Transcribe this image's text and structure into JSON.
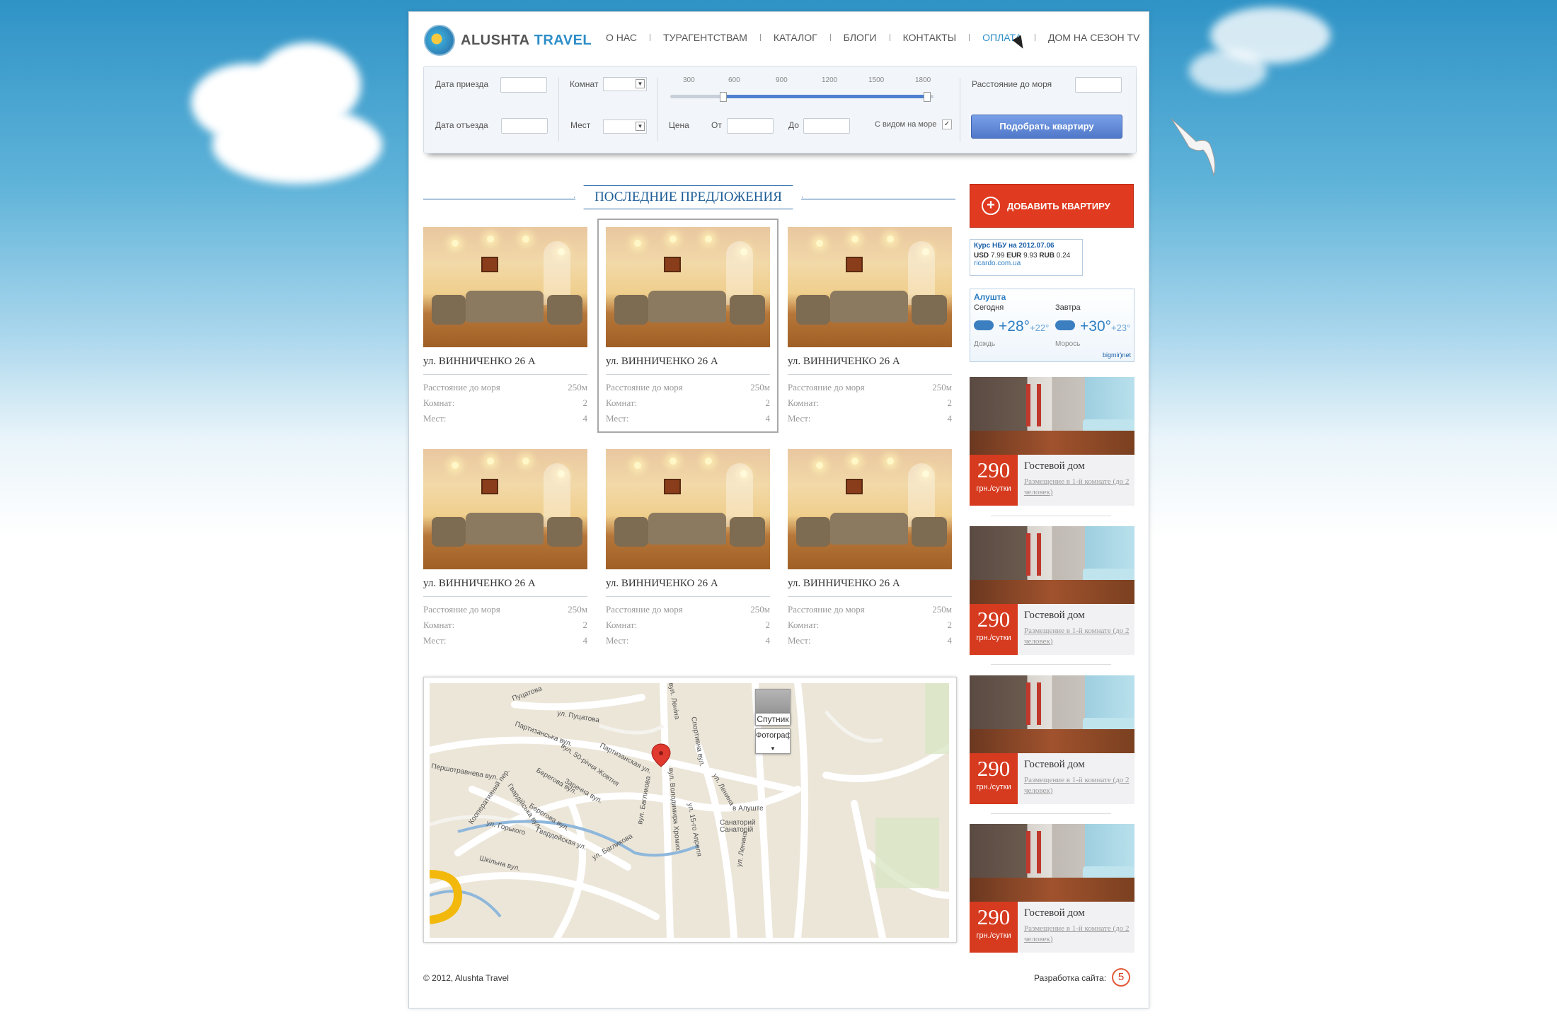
{
  "brand": {
    "name_part1": "ALUSHTA",
    "name_part2": "TRAVEL"
  },
  "nav": {
    "items": [
      {
        "label": "О НАС",
        "active": false
      },
      {
        "label": "ТУРАГЕНТСТВАМ",
        "active": false
      },
      {
        "label": "КАТАЛОГ",
        "active": false
      },
      {
        "label": "БЛОГИ",
        "active": false
      },
      {
        "label": "КОНТАКТЫ",
        "active": false
      },
      {
        "label": "ОПЛАТА",
        "active": true
      },
      {
        "label": "ДОМ НА СЕЗОН TV",
        "active": false
      }
    ]
  },
  "search": {
    "arrival_label": "Дата приезда",
    "departure_label": "Дата отъезда",
    "rooms_label": "Комнат",
    "beds_label": "Мест",
    "price_label": "Цена",
    "from_label": "От",
    "to_label": "До",
    "sea_view_label": "С видом на море",
    "sea_view_checked": true,
    "distance_label": "Расстояние до моря",
    "submit_label": "Подобрать квартиру",
    "slider_ticks": [
      "300",
      "600",
      "900",
      "1200",
      "1500",
      "1800"
    ],
    "slider_range": [
      600,
      1800
    ]
  },
  "offers_title": "ПОСЛЕДНИЕ ПРЕДЛОЖЕНИЯ",
  "listings": [
    {
      "address": "ул. ВИННИЧЕНКО 26 А",
      "distance_label": "Расстояние до моря",
      "distance": "250м",
      "rooms_label": "Комнат:",
      "rooms": "2",
      "beds_label": "Мест:",
      "beds": "4"
    },
    {
      "address": "ул. ВИННИЧЕНКО 26 А",
      "distance_label": "Расстояние до моря",
      "distance": "250м",
      "rooms_label": "Комнат:",
      "rooms": "2",
      "beds_label": "Мест:",
      "beds": "4"
    },
    {
      "address": "ул. ВИННИЧЕНКО 26 А",
      "distance_label": "Расстояние до моря",
      "distance": "250м",
      "rooms_label": "Комнат:",
      "rooms": "2",
      "beds_label": "Мест:",
      "beds": "4"
    },
    {
      "address": "ул. ВИННИЧЕНКО 26 А",
      "distance_label": "Расстояние до моря",
      "distance": "250м",
      "rooms_label": "Комнат:",
      "rooms": "2",
      "beds_label": "Мест:",
      "beds": "4"
    },
    {
      "address": "ул. ВИННИЧЕНКО 26 А",
      "distance_label": "Расстояние до моря",
      "distance": "250м",
      "rooms_label": "Комнат:",
      "rooms": "2",
      "beds_label": "Мест:",
      "beds": "4"
    },
    {
      "address": "ул. ВИННИЧЕНКО 26 А",
      "distance_label": "Расстояние до моря",
      "distance": "250м",
      "rooms_label": "Комнат:",
      "rooms": "2",
      "beds_label": "Мест:",
      "beds": "4"
    }
  ],
  "map": {
    "satellite_label": "Спутник",
    "photos_label": "Фотограф",
    "street_labels": [
      "Пуцатова",
      "ул. Пуцатова",
      "Партизанська вул.",
      "Партизанская ул.",
      "Першотравнева вул.",
      "Кооперативний пер.",
      "Гвардійська вул.",
      "Берегова вул.",
      "вул. 50-річчя Жовтня",
      "Заречна вул.",
      "Берегова вул.",
      "Гвардейская ул.",
      "ул. Горького",
      "Шкільна вул.",
      "ул. Багликова",
      "вул. Багликова",
      "вул. Володимира Хромих",
      "ул. 15-го Апреля",
      "ул. Ленина",
      "вул. Леніна",
      "Спортивна вул.",
      "Санаторий",
      "Санаторій",
      "в Алуште",
      "ул. Ленина"
    ]
  },
  "sidebar": {
    "add_label": "ДОБАВИТЬ КВАРТИРУ",
    "rates": {
      "title": "Курс НБУ на 2012.07.06",
      "usd_label": "USD",
      "usd": "7.99",
      "eur_label": "EUR",
      "eur": "9.93",
      "rub_label": "RUB",
      "rub": "0.24",
      "source": "ricardo.com.ua"
    },
    "weather": {
      "city": "Алушта",
      "today_label": "Сегодня",
      "tomorrow_label": "Завтра",
      "today_temp": "+28°",
      "today_low": "+22°",
      "tomorrow_temp": "+30°",
      "tomorrow_low": "+23°",
      "today_desc": "Дождь",
      "tomorrow_desc": "Морось",
      "source": "bigmir)net"
    },
    "offers": [
      {
        "price": "290",
        "unit": "грн./сутки",
        "title": "Гостевой дом",
        "desc": "Размещение в 1-й комнате (до 2 человек)"
      },
      {
        "price": "290",
        "unit": "грн./сутки",
        "title": "Гостевой дом",
        "desc": "Размещение в 1-й комнате (до 2 человек)"
      },
      {
        "price": "290",
        "unit": "грн./сутки",
        "title": "Гостевой дом",
        "desc": "Размещение в 1-й комнате (до 2 человек)"
      },
      {
        "price": "290",
        "unit": "грн./сутки",
        "title": "Гостевой дом",
        "desc": "Размещение в 1-й комнате (до 2 человек)"
      }
    ]
  },
  "footer": {
    "copyright": "© 2012, Alushta Travel",
    "dev_label": "Разработка сайта:",
    "dev_logo": "5"
  }
}
